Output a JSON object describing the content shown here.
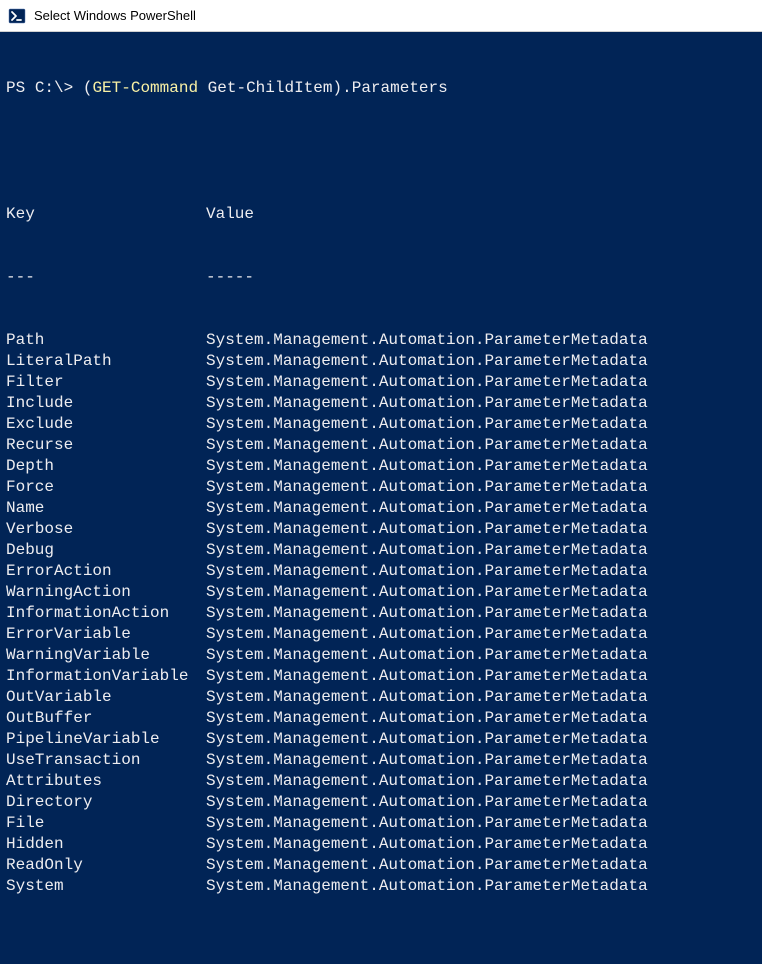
{
  "window": {
    "title": "Select Windows PowerShell"
  },
  "prompt": {
    "ps_prefix": "PS ",
    "path": "C:\\",
    "gt": "> ",
    "paren_open": "(",
    "cmdlet": "GET-Command",
    "space": " ",
    "arg": "Get-ChildItem",
    "paren_close": ")",
    "member": ".Parameters"
  },
  "table": {
    "header_key": "Key",
    "header_value": "Value",
    "divider_key": "---",
    "divider_value": "-----",
    "value_text": "System.Management.Automation.ParameterMetadata",
    "rows": [
      "Path",
      "LiteralPath",
      "Filter",
      "Include",
      "Exclude",
      "Recurse",
      "Depth",
      "Force",
      "Name",
      "Verbose",
      "Debug",
      "ErrorAction",
      "WarningAction",
      "InformationAction",
      "ErrorVariable",
      "WarningVariable",
      "InformationVariable",
      "OutVariable",
      "OutBuffer",
      "PipelineVariable",
      "UseTransaction",
      "Attributes",
      "Directory",
      "File",
      "Hidden",
      "ReadOnly",
      "System"
    ]
  }
}
